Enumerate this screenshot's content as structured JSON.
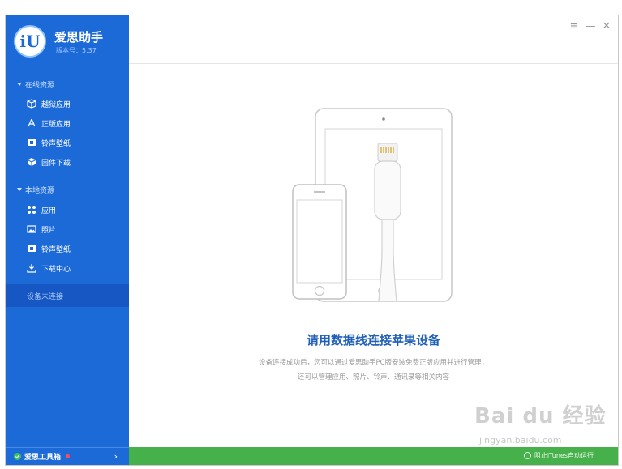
{
  "app": {
    "title": "爱思助手",
    "version_label": "版本号：5.37",
    "logo_text": "iU"
  },
  "sidebar": {
    "online_header": "在线资源",
    "online_items": [
      {
        "label": "越狱应用",
        "icon": "box-icon"
      },
      {
        "label": "正版应用",
        "icon": "appstore-icon"
      },
      {
        "label": "铃声壁纸",
        "icon": "film-icon"
      },
      {
        "label": "固件下载",
        "icon": "cube-icon"
      }
    ],
    "local_header": "本地资源",
    "local_items": [
      {
        "label": "应用",
        "icon": "apps-grid-icon"
      },
      {
        "label": "照片",
        "icon": "photo-icon"
      },
      {
        "label": "铃声壁纸",
        "icon": "film-icon"
      },
      {
        "label": "下载中心",
        "icon": "download-icon"
      }
    ],
    "device_status": "设备未连接",
    "toolbox_label": "爱思工具箱",
    "toolbox_arrow": "›"
  },
  "window_controls": {
    "menu": "≡",
    "minimize": "—",
    "close": "✕"
  },
  "main": {
    "headline": "请用数据线连接苹果设备",
    "desc_line1": "设备连接成功后，您可以通过爱思助手PC版安装免费正版应用并进行管理，",
    "desc_line2": "还可以管理应用、照片、铃声、通讯录等相关内容"
  },
  "status_bar": {
    "itunes_option": "阻止iTunes自动运行"
  },
  "watermark": {
    "top": "Bai du 经验",
    "bottom": "jingyan.baidu.com"
  },
  "colors": {
    "sidebar": "#1c6ad8",
    "headline": "#2160b8",
    "status_bar": "#46b04a"
  }
}
